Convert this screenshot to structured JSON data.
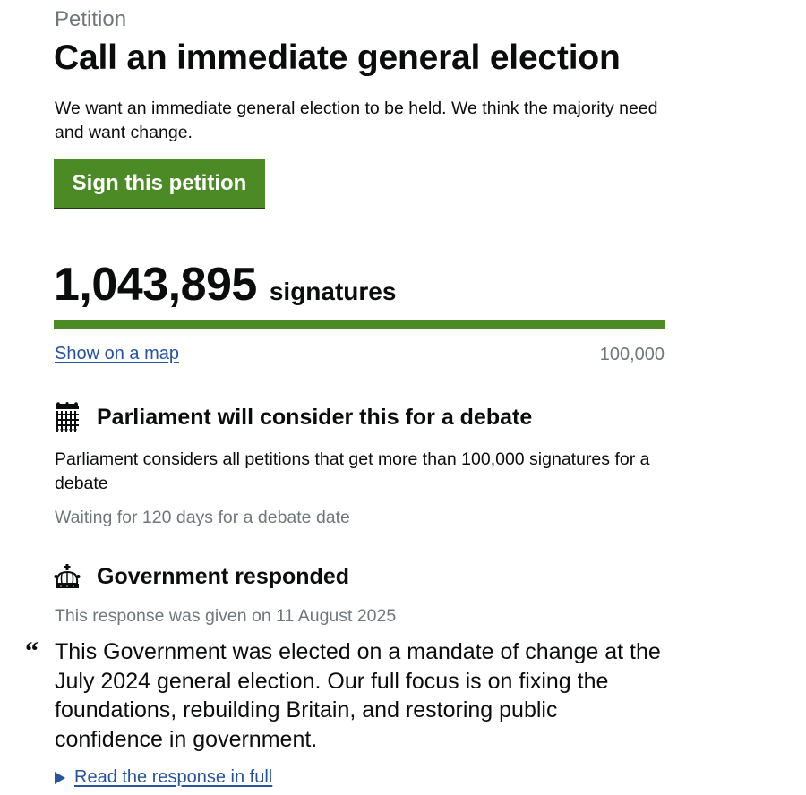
{
  "petition": {
    "eyebrow": "Petition",
    "title": "Call an immediate general election",
    "summary": "We want an immediate general election to be held. We think the majority need and want change.",
    "sign_button": "Sign this petition"
  },
  "signatures": {
    "count": "1,043,895",
    "unit": "signatures",
    "progress_percent": 100,
    "map_link": "Show on a map",
    "threshold": "100,000"
  },
  "debate": {
    "icon": "portcullis-icon",
    "heading": "Parliament will consider this for a debate",
    "body": "Parliament considers all petitions that get more than 100,000 signatures for a debate",
    "status": "Waiting for 120 days for a debate date"
  },
  "response": {
    "icon": "crown-icon",
    "heading": "Government responded",
    "date_text": "This response was given on 11 August 2025",
    "quote_mark": "“",
    "quote": "This Government was elected on a mandate of change at the July 2024 general election. Our full focus is on fixing the foundations, rebuilding Britain, and restoring public confidence in government.",
    "read_more": "Read the response in full"
  },
  "colors": {
    "primary_button": "#4c8a26",
    "link": "#2553a0",
    "secondary_text": "#6f777b"
  }
}
